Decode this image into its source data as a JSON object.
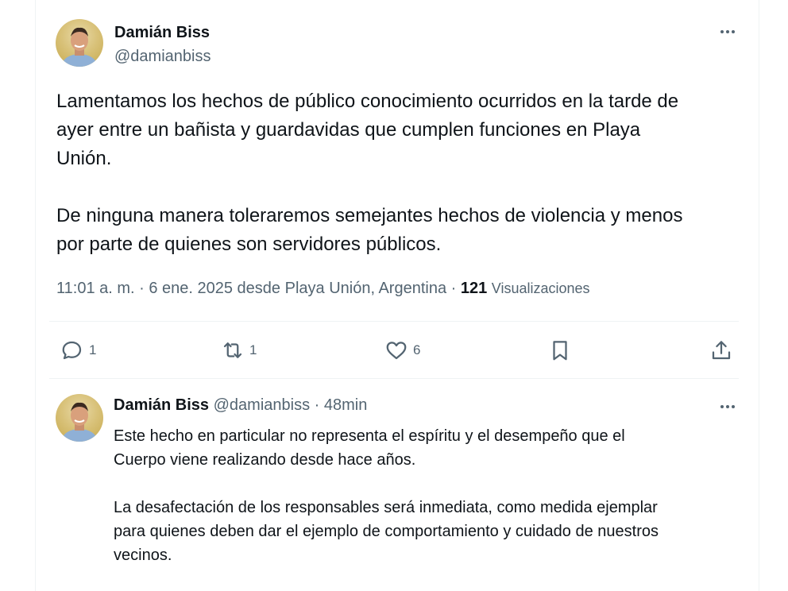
{
  "main_tweet": {
    "author_name": "Damián Biss",
    "author_handle": "@damianbiss",
    "text": "Lamentamos los hechos de público conocimiento ocurridos en la tarde de\nayer entre un bañista y guardavidas que cumplen funciones en Playa\nUnión.\n\nDe ninguna manera toleraremos semejantes hechos de violencia y menos\npor parte de quienes son servidores públicos.",
    "meta_prefix": "11:01 a. m. · 6 ene. 2025 desde Playa Unión, Argentina · ",
    "views_count": "121",
    "views_label": "Visualizaciones",
    "actions": {
      "reply_count": "1",
      "retweet_count": "1",
      "like_count": "6"
    }
  },
  "reply_tweet": {
    "author_name": "Damián Biss",
    "author_handle": "@damianbiss",
    "separator": " · ",
    "time": "48min",
    "text": "Este hecho en particular no representa el espíritu y el desempeño que el\nCuerpo viene realizando desde hace años.\n\nLa desafectación de los responsables será inmediata, como medida ejemplar\npara quienes deben dar el ejemplo de comportamiento y cuidado de nuestros\nvecinos."
  },
  "icons": {
    "more": "more-horizontal-icon",
    "reply": "reply-bubble-icon",
    "retweet": "retweet-icon",
    "like": "heart-icon",
    "bookmark": "bookmark-icon",
    "share": "share-upload-icon"
  },
  "colors": {
    "text_primary": "#0f1419",
    "text_secondary": "#536471",
    "divider": "#eff3f4"
  }
}
